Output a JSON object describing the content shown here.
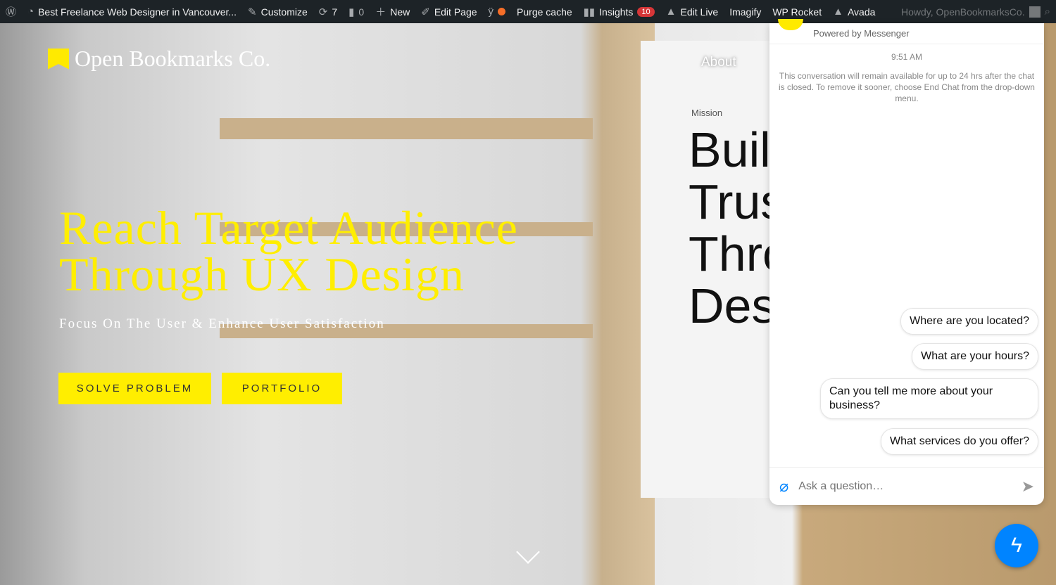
{
  "adminbar": {
    "site": "Best Freelance Web Designer in Vancouver...",
    "customize": "Customize",
    "updates": "7",
    "comments": "0",
    "new": "New",
    "edit_page": "Edit Page",
    "purge": "Purge cache",
    "insights": "Insights",
    "insights_count": "10",
    "edit_live": "Edit Live",
    "imagify": "Imagify",
    "wp_rocket": "WP Rocket",
    "avada": "Avada",
    "howdy": "Howdy, OpenBookmarksCo."
  },
  "hero": {
    "logo": "Open Bookmarks Co.",
    "title_line1": "Reach Target Audience",
    "title_line2": "Through UX Design",
    "subtitle": "Focus On The User & Enhance User Satisfaction",
    "btn1": "SOLVE PROBLEM",
    "btn2": "PORTFOLIO",
    "accent": "#ffee00"
  },
  "about": {
    "title": "About",
    "mission": "Mission",
    "big": [
      "Buil",
      "Trus",
      "Thro",
      "Des"
    ]
  },
  "chat": {
    "powered": "Powered by Messenger",
    "time": "9:51 AM",
    "note": "This conversation will remain available for up to 24 hrs after the chat is closed. To remove it sooner, choose End Chat from the drop-down menu.",
    "replies": [
      "Where are you located?",
      "What are your hours?",
      "Can you tell me more about your business?",
      "What services do you offer?"
    ],
    "placeholder": "Ask a question…",
    "brand": "#0084ff"
  }
}
